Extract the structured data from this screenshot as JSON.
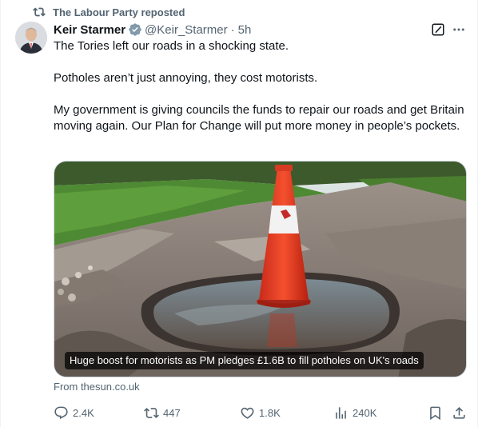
{
  "repost": {
    "label": "The Labour Party reposted",
    "icon": "repost-icon"
  },
  "author": {
    "name": "Keir Starmer",
    "handle": "@Keir_Starmer",
    "separator": "·",
    "time": "5h",
    "verified_color": "#829aab"
  },
  "tweet": {
    "paragraphs": [
      "The Tories left our roads in a shocking state.",
      "Potholes aren’t just annoying, they cost motorists.",
      "My government is giving councils the funds to repair our roads and get Britain moving again. Our Plan for Change will put more money in people’s pockets."
    ]
  },
  "card": {
    "caption": "Huge boost for motorists as PM pledges £1.6B to fill potholes on UK's roads",
    "source": "From thesun.co.uk"
  },
  "actions": {
    "replies": "2.4K",
    "reposts": "447",
    "likes": "1.8K",
    "views": "240K"
  },
  "colors": {
    "text": "#0f1419",
    "secondary": "#536471",
    "border": "#cfd9de",
    "cone_orange": "#f0432a"
  }
}
